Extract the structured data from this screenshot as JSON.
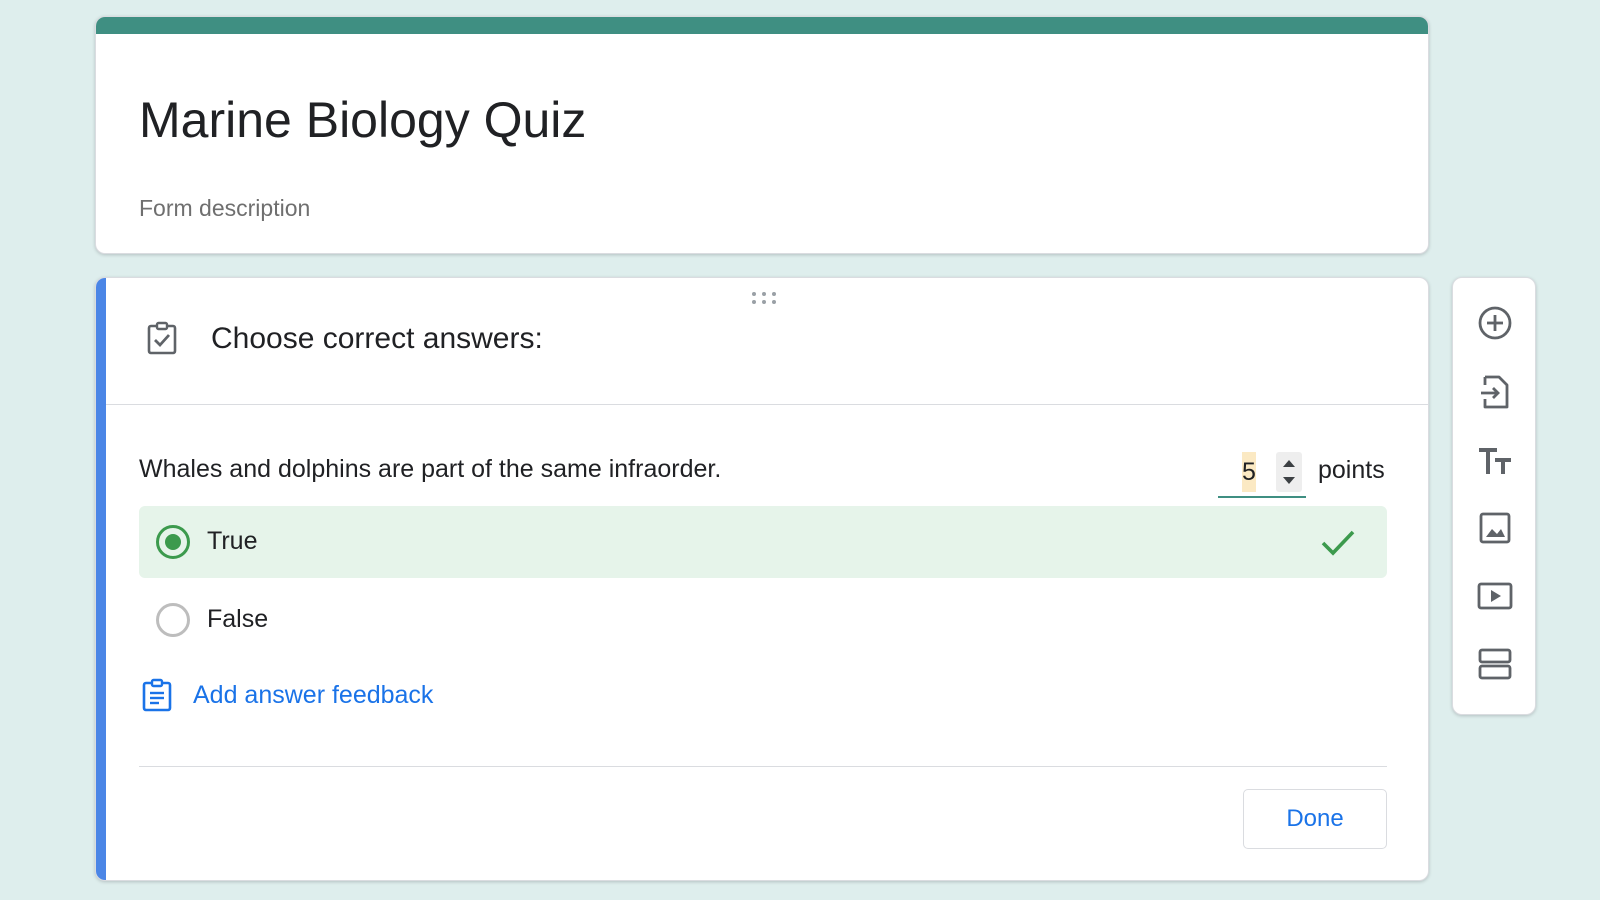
{
  "form": {
    "title": "Marine Biology Quiz",
    "description": "Form description",
    "accent_color": "#3f8f82"
  },
  "question": {
    "answer_key_title": "Choose correct answers:",
    "text": "Whales and dolphins are part of the same infraorder.",
    "points_value": "5",
    "points_label": "points",
    "options": [
      {
        "label": "True",
        "selected": true,
        "correct": true
      },
      {
        "label": "False",
        "selected": false,
        "correct": false
      }
    ],
    "feedback_link": "Add answer feedback",
    "done_label": "Done",
    "correct_color": "#3c9a4d",
    "active_bar_color": "#4b86e6"
  },
  "toolbar": {
    "items": [
      {
        "icon": "add-question-icon"
      },
      {
        "icon": "import-questions-icon"
      },
      {
        "icon": "add-title-description-icon"
      },
      {
        "icon": "add-image-icon"
      },
      {
        "icon": "add-video-icon"
      },
      {
        "icon": "add-section-icon"
      }
    ]
  }
}
